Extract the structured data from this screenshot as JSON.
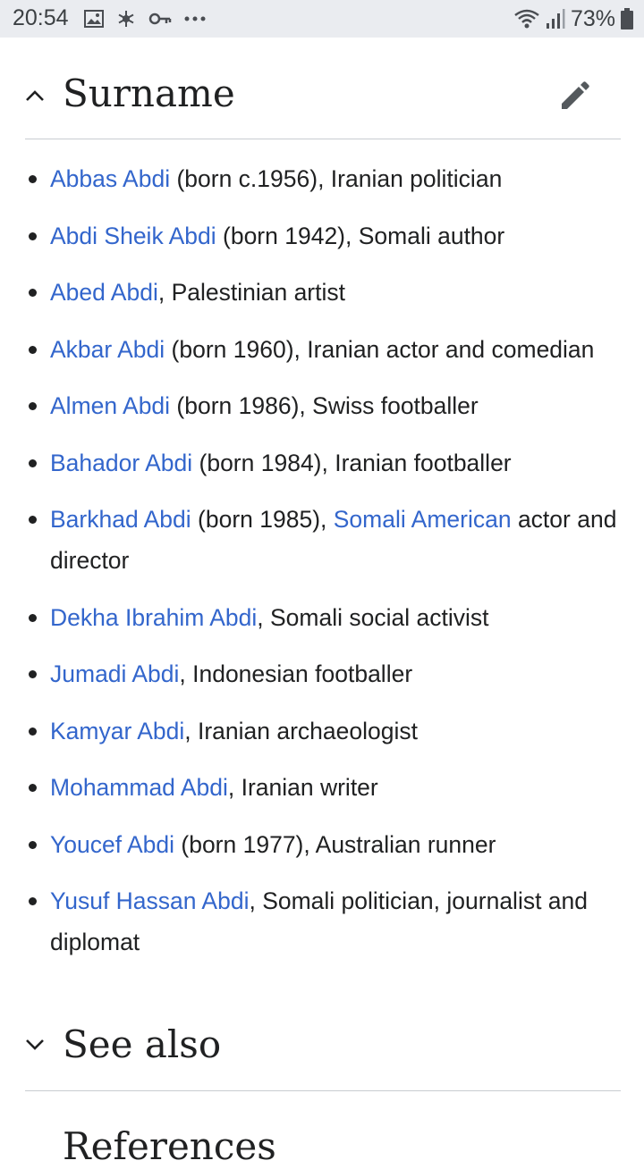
{
  "status_bar": {
    "time": "20:54",
    "battery_percent": "73%",
    "icons": [
      "image-icon",
      "snowflake-icon",
      "key-icon",
      "more-dots-icon",
      "wifi-icon",
      "signal-icon",
      "battery-icon"
    ]
  },
  "surname_section": {
    "title": "Surname",
    "expanded": true,
    "people": [
      {
        "name": "Abbas Abdi",
        "desc": " (born c.1956), Iranian politician"
      },
      {
        "name": "Abdi Sheik Abdi",
        "desc": " (born 1942), Somali author"
      },
      {
        "name": "Abed Abdi",
        "desc": ", Palestinian artist"
      },
      {
        "name": "Akbar Abdi",
        "desc": " (born 1960), Iranian actor and comedian"
      },
      {
        "name": "Almen Abdi",
        "desc": " (born 1986), Swiss footballer"
      },
      {
        "name": "Bahador Abdi",
        "desc": " (born 1984), Iranian footballer"
      },
      {
        "name": "Barkhad Abdi",
        "desc": " (born 1985), ",
        "link2": "Somali American",
        "desc2": " actor and director"
      },
      {
        "name": "Dekha Ibrahim Abdi",
        "desc": ", Somali social activist"
      },
      {
        "name": "Jumadi Abdi",
        "desc": ", Indonesian footballer"
      },
      {
        "name": "Kamyar Abdi",
        "desc": ", Iranian archaeologist"
      },
      {
        "name": "Mohammad Abdi",
        "desc": ", Iranian writer"
      },
      {
        "name": "Youcef Abdi",
        "desc": " (born 1977), Australian runner"
      },
      {
        "name": "Yusuf Hassan Abdi",
        "desc": ", Somali politician, journalist and diplomat"
      }
    ]
  },
  "see_also_section": {
    "title": "See also",
    "expanded": false
  },
  "references_section": {
    "title": "References"
  },
  "colors": {
    "link": "#3366cc",
    "text": "#202122",
    "divider": "#c8ccd1",
    "status_bar": "#eaecf0"
  }
}
